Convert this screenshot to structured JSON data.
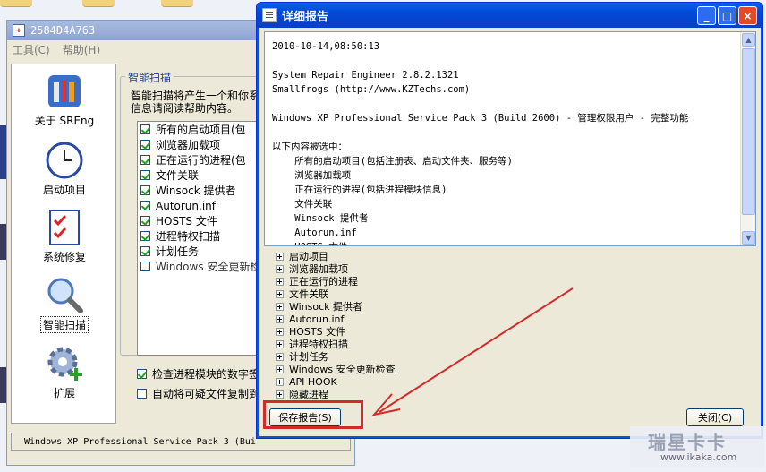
{
  "back_window": {
    "title": "2584D4A763",
    "menu": [
      "工具(C)",
      "帮助(H)"
    ],
    "nav": [
      {
        "label": "关于 SREng",
        "icon": "tools-icon"
      },
      {
        "label": "启动项目",
        "icon": "clock-icon"
      },
      {
        "label": "系统修复",
        "icon": "checklist-icon"
      },
      {
        "label": "智能扫描",
        "icon": "magnifier-icon"
      },
      {
        "label": "扩展",
        "icon": "gear-plus-icon"
      }
    ],
    "section_title": "智能扫描",
    "description_lines": [
      "智能扫描将产生一个和你系",
      "信息请阅读帮助内容。"
    ],
    "options": [
      {
        "label": "所有的启动项目(包",
        "checked": true
      },
      {
        "label": "浏览器加载项",
        "checked": true
      },
      {
        "label": "正在运行的进程(包",
        "checked": true
      },
      {
        "label": "文件关联",
        "checked": true
      },
      {
        "label": "Winsock 提供者",
        "checked": true
      },
      {
        "label": "Autorun.inf",
        "checked": true
      },
      {
        "label": "HOSTS 文件",
        "checked": true
      },
      {
        "label": "进程特权扫描",
        "checked": true
      },
      {
        "label": "计划任务",
        "checked": true
      },
      {
        "label": "Windows 安全更新检查",
        "checked": false
      }
    ],
    "bottom_options": [
      {
        "label": "检查进程模块的数字签",
        "checked": true
      },
      {
        "label": "自动将可疑文件复制到",
        "checked": false
      }
    ],
    "status": "Windows XP Professional Service Pack 3 (Bui"
  },
  "dialog": {
    "title": "详细报告",
    "title_buttons": [
      "_",
      "□",
      "×"
    ],
    "report_lines": [
      "2010-10-14,08:50:13",
      "",
      "System Repair Engineer 2.8.2.1321",
      "Smallfrogs (http://www.KZTechs.com)",
      "",
      "Windows XP Professional Service Pack 3 (Build 2600) - 管理权限用户 - 完整功能",
      "",
      "以下内容被选中：",
      "    所有的启动项目(包括注册表、启动文件夹、服务等)",
      "    浏览器加载项",
      "    正在运行的进程(包括进程模块信息)",
      "    文件关联",
      "    Winsock 提供者",
      "    Autorun.inf",
      "    HOSTS 文件"
    ],
    "tree": [
      "启动项目",
      "浏览器加载项",
      "正在运行的进程",
      "文件关联",
      "Winsock 提供者",
      "Autorun.inf",
      "HOSTS 文件",
      "进程特权扫描",
      "计划任务",
      "Windows 安全更新检查",
      "API HOOK",
      "隐藏进程"
    ],
    "save_button": "保存报告(S)",
    "close_button": "关闭(C)"
  },
  "watermark": {
    "brand": "瑞星卡卡",
    "url": "www.ikaka.com"
  },
  "colors": {
    "title_bar": "#0a52e0",
    "highlight": "#d42a2a",
    "arrow": "#d42a2a"
  }
}
